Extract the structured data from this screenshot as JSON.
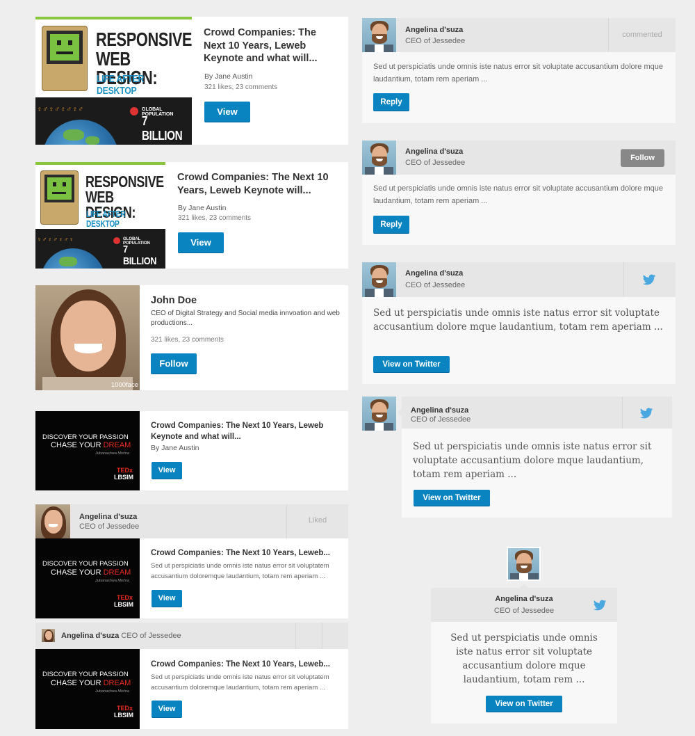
{
  "colors": {
    "accent": "#0a84c1",
    "background": "#eeeeee",
    "header_grey": "#e6e6e6",
    "green_rule": "#8ac53e"
  },
  "promo": {
    "line1": "RESPONSIVE",
    "line2": "WEB DESIGN:",
    "line3": "LIFE AFTER DESKTOP",
    "gp_small": "GLOBAL POPULATION",
    "gp_big": "7 BILLION"
  },
  "ted": {
    "line1": "DISCOVER YOUR PASSION",
    "line2_a": "CHASE YOUR ",
    "line2_b": "DREAM",
    "author": "Jubanashwa Mishra",
    "tedx": "TEDx",
    "lbsim": "LBSIM"
  },
  "left": {
    "card1": {
      "title": "Crowd Companies: The Next 10 Years, Leweb Keynote and what will...",
      "author": "By Jane Austin",
      "stats": "321 likes, 23 comments",
      "button": "View"
    },
    "card2": {
      "title": "Crowd Companies: The Next 10 Years, Leweb Keynote will...",
      "author": "By Jane Austin",
      "stats": "321 likes, 23 comments",
      "button": "View"
    },
    "card3": {
      "name": "John Doe",
      "desc": "CEO of Digital Strategy and Social media innvoation and web productions...",
      "stats": "321 likes, 23 comments",
      "button": "Follow",
      "watermark": "1000face"
    },
    "card4": {
      "title": "Crowd Companies: The Next 10 Years, Leweb Keynote and what will...",
      "author": "By Jane Austin",
      "button": "View"
    },
    "card5": {
      "name": "Angelina d'suza",
      "role": "CEO of Jessedee",
      "status": "Liked",
      "title": "Crowd Companies: The Next 10 Years, Leweb...",
      "desc": "Sed ut perspiciatis unde omnis iste natus error sit voluptatem accusantium doloremque laudantium, totam rem aperiam ...",
      "button": "View"
    },
    "card6": {
      "name": "Angelina d'suza",
      "role": "CEO of Jessedee",
      "title": "Crowd Companies: The Next 10 Years, Leweb...",
      "desc": "Sed ut perspiciatis unde omnis iste natus error sit voluptatem accusantium doloremque laudantium, totam rem aperiam ...",
      "button": "View"
    }
  },
  "right": {
    "card1": {
      "name": "Angelina d'suza",
      "role": "CEO of Jessedee",
      "status": "commented",
      "text": "Sed ut perspiciatis unde omnis iste natus error sit voluptate accusantium dolore mque laudantium, totam rem aperiam ...",
      "button": "Reply"
    },
    "card2": {
      "name": "Angelina d'suza",
      "role": "CEO of Jessedee",
      "follow": "Follow",
      "text": "Sed ut perspiciatis unde omnis iste natus error sit voluptate accusantium dolore mque laudantium, totam rem aperiam ...",
      "button": "Reply"
    },
    "card3": {
      "name": "Angelina d'suza",
      "role": "CEO of Jessedee",
      "text": "Sed ut perspiciatis unde omnis iste natus error sit voluptate accusantium dolore mque laudantium, totam rem aperiam ...",
      "button": "View on Twitter",
      "icon": "twitter-icon"
    },
    "card4": {
      "name": "Angelina d'suza",
      "role": "CEO of Jessedee",
      "text": "Sed ut perspiciatis unde omnis iste natus error sit voluptate accusantium dolore mque laudantium, totam rem aperiam ...",
      "button": "View on Twitter",
      "icon": "twitter-icon"
    },
    "card5": {
      "name": "Angelina d'suza",
      "role": "CEO of Jessedee",
      "text": "Sed ut perspiciatis unde omnis iste natus error sit voluptate accusantium dolore mque laudantium, totam rem ...",
      "button": "View on Twitter",
      "icon": "twitter-icon"
    }
  }
}
